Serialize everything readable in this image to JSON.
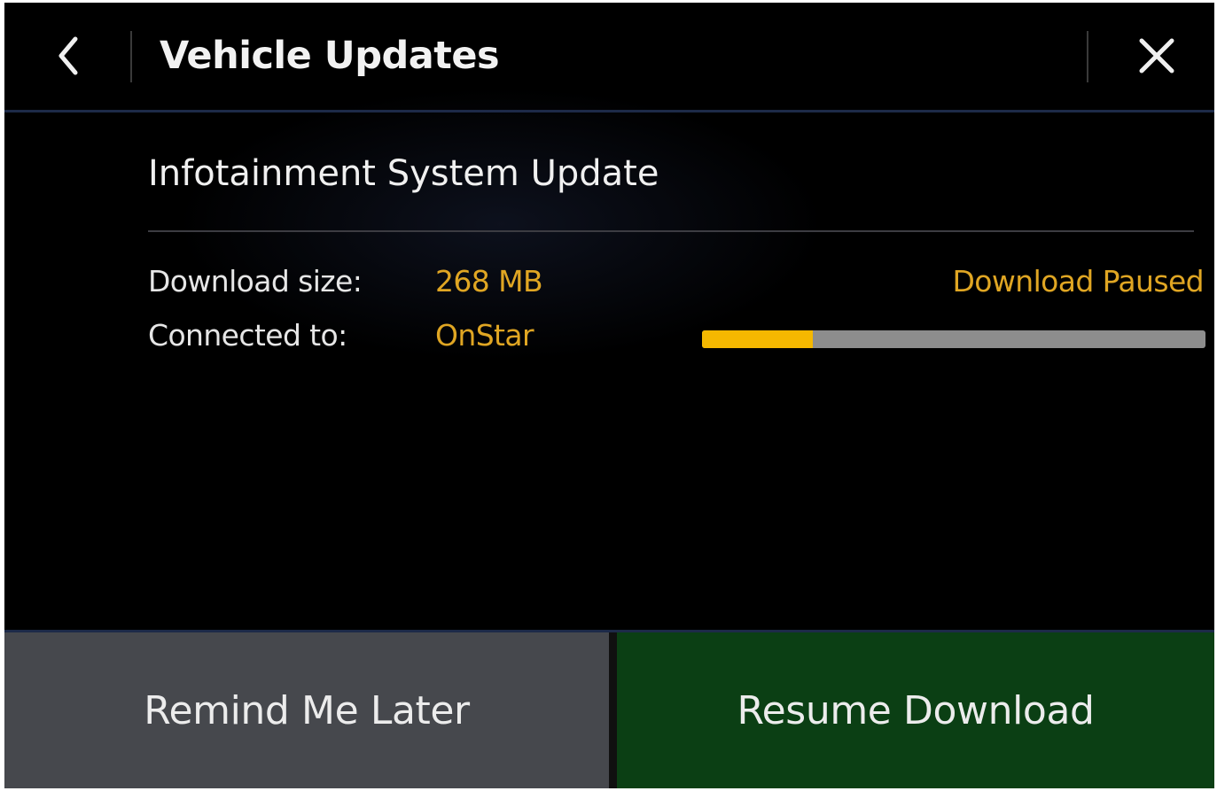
{
  "header": {
    "title": "Vehicle Updates",
    "back_icon": "chevron-left-icon",
    "close_icon": "close-icon"
  },
  "update": {
    "title": "Infotainment System Update",
    "download_size_label": "Download size:",
    "download_size_value": "268 MB",
    "connected_label": "Connected to:",
    "connected_value": "OnStar",
    "status": "Download Paused",
    "progress_fraction": 0.22
  },
  "buttons": {
    "remind_label": "Remind Me Later",
    "resume_label": "Resume Download"
  },
  "colors": {
    "accent": "#e0a623",
    "progress_fill": "#f5b800",
    "progress_track": "#8d8d8d",
    "remind_bg": "#46484d",
    "resume_bg": "#0b3f14",
    "button_text": "#ececec"
  }
}
